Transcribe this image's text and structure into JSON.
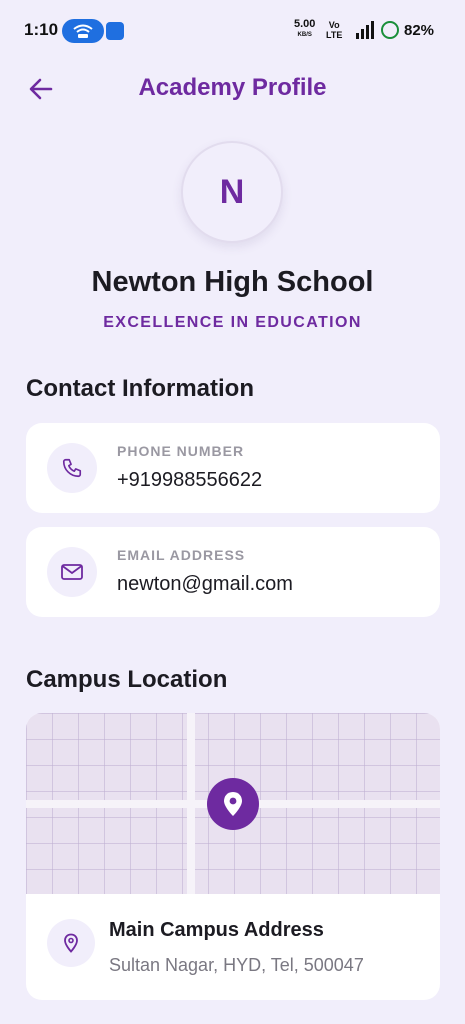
{
  "status_bar": {
    "time": "1:10",
    "net_speed": "5.00",
    "net_unit": "KB/S",
    "volte_top": "Vo",
    "volte_bottom": "LTE",
    "battery": "82%"
  },
  "header": {
    "title": "Academy Profile",
    "back_icon": "arrow-left-icon"
  },
  "profile": {
    "initial": "N",
    "name": "Newton High School",
    "tagline": "EXCELLENCE IN EDUCATION"
  },
  "contact": {
    "section_title": "Contact Information",
    "phone": {
      "label": "PHONE NUMBER",
      "value": "+919988556622",
      "icon": "phone-icon"
    },
    "email": {
      "label": "EMAIL ADDRESS",
      "value": "newton@gmail.com",
      "icon": "mail-icon"
    }
  },
  "location": {
    "section_title": "Campus Location",
    "address_title": "Main Campus Address",
    "address": "Sultan Nagar, HYD, Tel, 500047",
    "icon": "map-pin-icon"
  },
  "colors": {
    "accent": "#6e2aa0",
    "background": "#f1eefb",
    "card": "#ffffff"
  }
}
